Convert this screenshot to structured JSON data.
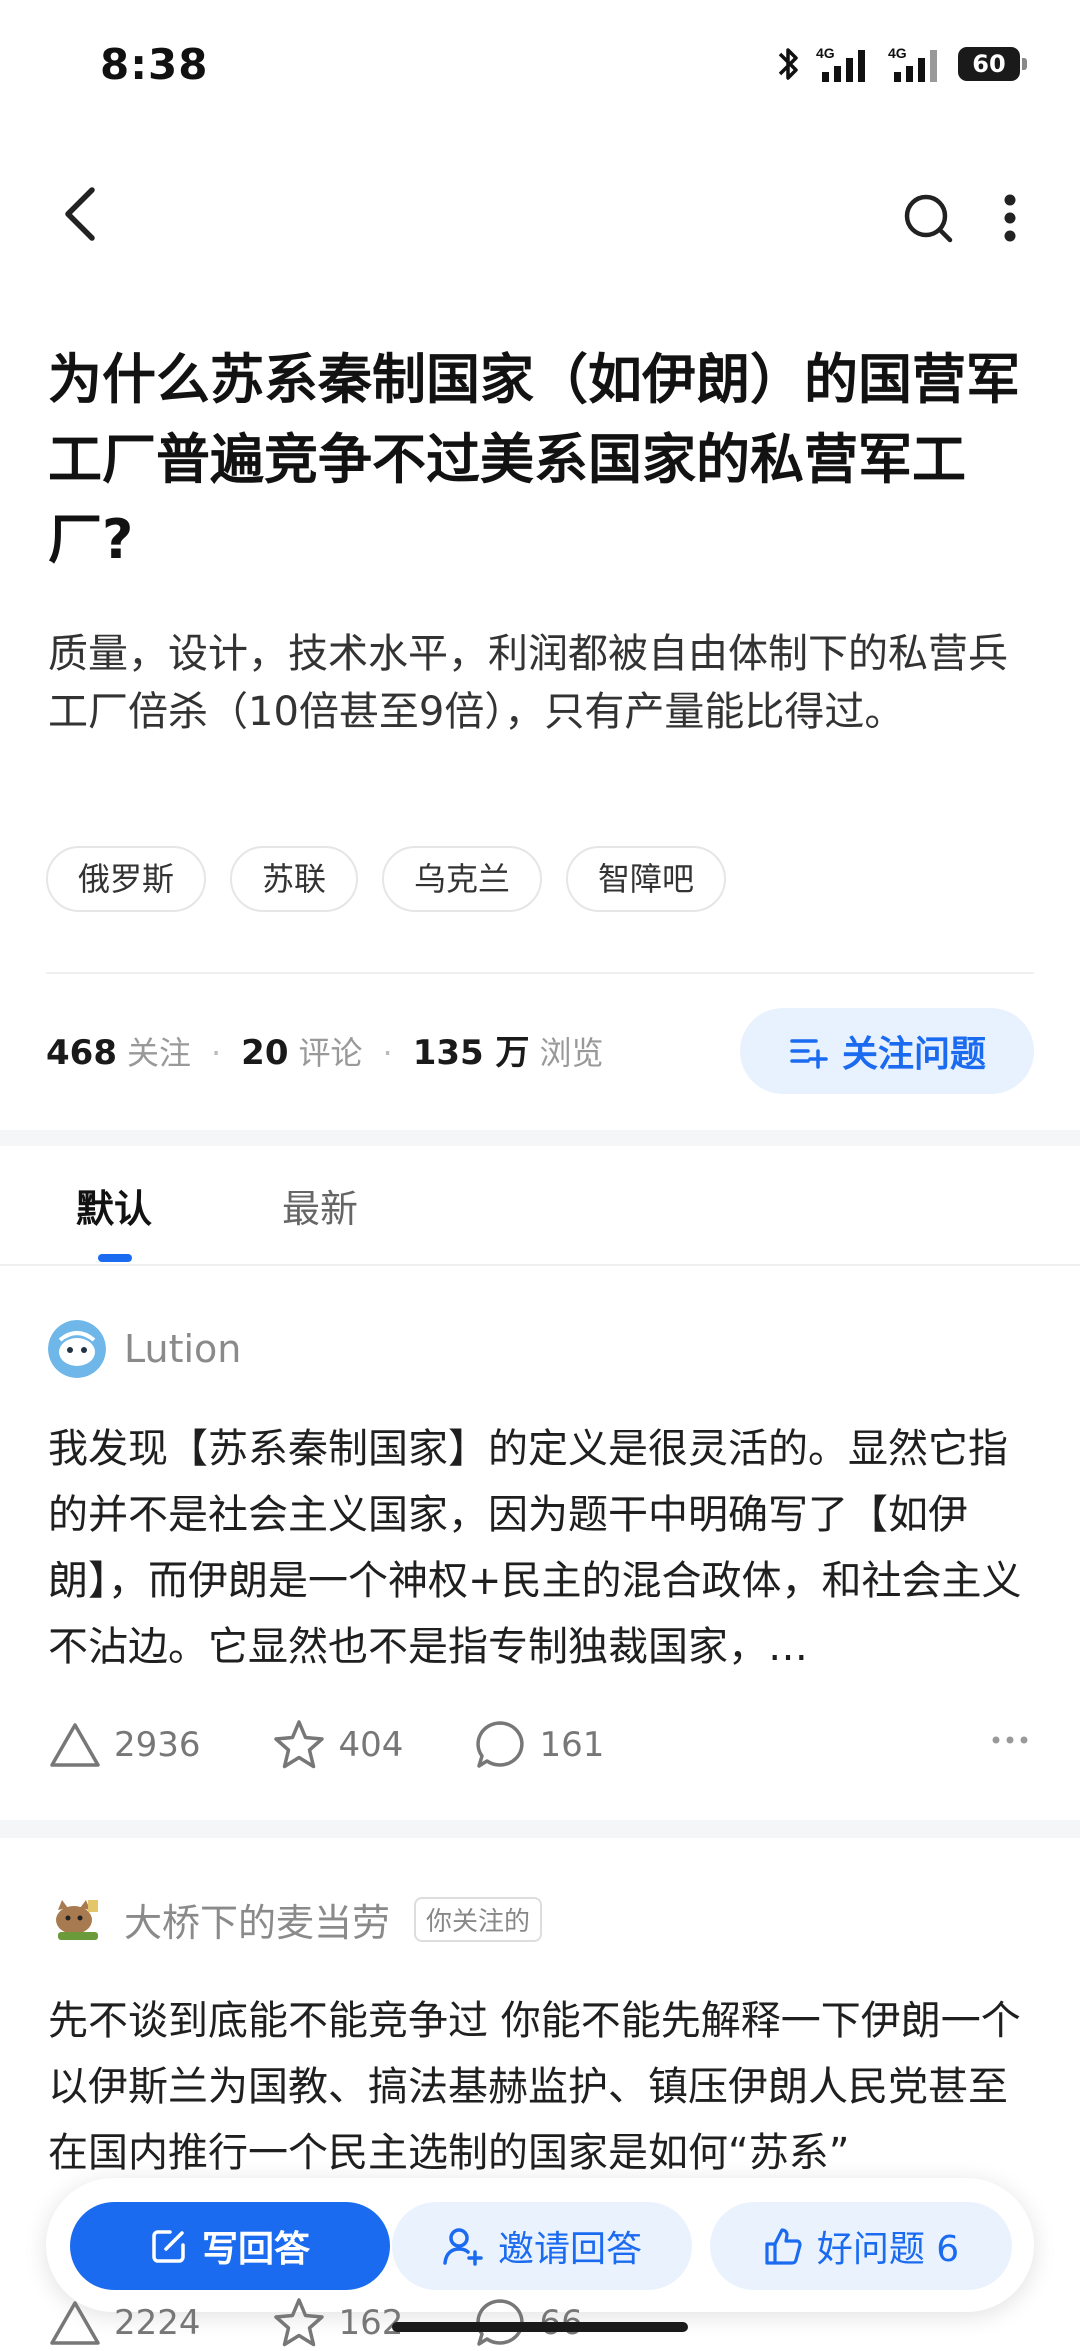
{
  "status": {
    "time": "8:38",
    "battery": "60",
    "network1": "4G",
    "network2": "4G"
  },
  "question": {
    "title": "为什么苏系秦制国家（如伊朗）的国营军工厂普遍竞争不过美系国家的私营军工厂?",
    "description": "质量，设计，技术水平，利润都被自由体制下的私营兵工厂倍杀（10倍甚至9倍），只有产量能比得过。",
    "tags": [
      "俄罗斯",
      "苏联",
      "乌克兰",
      "智障吧"
    ],
    "stats": {
      "follow_count": "468",
      "follow_label": "关注",
      "comment_count": "20",
      "comment_label": "评论",
      "view_count": "135 万",
      "view_label": "浏览"
    },
    "follow_button": "关注问题"
  },
  "sort_tabs": {
    "default": "默认",
    "latest": "最新"
  },
  "answers": [
    {
      "author": "Lution",
      "excerpt": "我发现【苏系秦制国家】的定义是很灵活的。显然它指的并不是社会主义国家，因为题干中明确写了【如伊朗】，而伊朗是一个神权+民主的混合政体，和社会主义不沾边。它显然也不是指专制独裁国家，…",
      "upvotes": "2936",
      "favorites": "404",
      "comments": "161"
    },
    {
      "author": "大桥下的麦当劳",
      "badge": "你关注的",
      "excerpt": "先不谈到底能不能竞争过 你能不能先解释一下伊朗一个以伊斯兰为国教、搞法基赫监护、镇压伊朗人民党甚至在国内推行一个民主选制的国家是如何“苏系”",
      "upvotes": "2224",
      "favorites": "162",
      "comments": "66"
    }
  ],
  "bottom_bar": {
    "write": "写回答",
    "invite": "邀请回答",
    "good_question": "好问题 6"
  },
  "colors": {
    "accent": "#1a6bf0",
    "accent_light": "#e8f1fe"
  }
}
